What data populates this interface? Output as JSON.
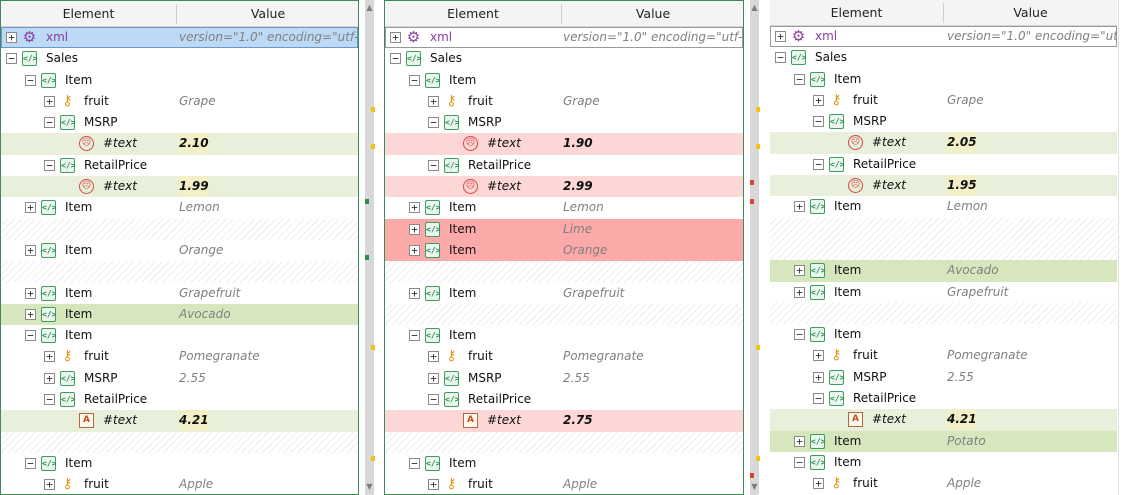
{
  "columns": {
    "element": "Element",
    "value": "Value"
  },
  "panes": {
    "left": [
      {
        "exp": "+",
        "icon": "gear",
        "name": "xml",
        "purple": true,
        "value": "version=\"1.0\" encoding=\"utf-",
        "state": "sel",
        "lvl": 0
      },
      {
        "exp": "-",
        "icon": "el",
        "name": "Sales",
        "lvl": 0
      },
      {
        "exp": "-",
        "icon": "el",
        "name": "Item",
        "lvl": 1
      },
      {
        "exp": "+",
        "icon": "key",
        "name": "fruit",
        "value": "Grape",
        "lvl": 2
      },
      {
        "exp": "-",
        "icon": "el",
        "name": "MSRP",
        "lvl": 2
      },
      {
        "icon": "sad",
        "name": "#text",
        "it": true,
        "value": "2.10",
        "num": true,
        "state": "diff-light",
        "lvl": 3
      },
      {
        "exp": "-",
        "icon": "el",
        "name": "RetailPrice",
        "lvl": 2
      },
      {
        "icon": "sad",
        "name": "#text",
        "it": true,
        "value": "1.99",
        "num": true,
        "state": "diff-light",
        "lvl": 3
      },
      {
        "exp": "+",
        "icon": "el",
        "name": "Item",
        "value": "Lemon",
        "lvl": 1
      },
      {
        "state": "hatch"
      },
      {
        "exp": "+",
        "icon": "el",
        "name": "Item",
        "value": "Orange",
        "lvl": 1
      },
      {
        "state": "hatch"
      },
      {
        "exp": "+",
        "icon": "el",
        "name": "Item",
        "value": "Grapefruit",
        "lvl": 1
      },
      {
        "exp": "+",
        "icon": "el",
        "name": "Item",
        "value": "Avocado",
        "state": "diff-green",
        "lvl": 1
      },
      {
        "exp": "-",
        "icon": "el",
        "name": "Item",
        "lvl": 1
      },
      {
        "exp": "+",
        "icon": "key",
        "name": "fruit",
        "value": "Pomegranate",
        "lvl": 2
      },
      {
        "exp": "+",
        "icon": "el",
        "name": "MSRP",
        "value": "2.55",
        "lvl": 2
      },
      {
        "exp": "-",
        "icon": "el",
        "name": "RetailPrice",
        "lvl": 2
      },
      {
        "icon": "doc",
        "name": "#text",
        "it": true,
        "value": "4.21",
        "num": true,
        "state": "diff-light",
        "lvl": 3
      },
      {
        "state": "hatch"
      },
      {
        "exp": "-",
        "icon": "el",
        "name": "Item",
        "lvl": 1
      },
      {
        "exp": "+",
        "icon": "key",
        "name": "fruit",
        "value": "Apple",
        "lvl": 2
      }
    ],
    "mid": [
      {
        "exp": "+",
        "icon": "gear",
        "name": "xml",
        "purple": true,
        "value": "version=\"1.0\" encoding=\"utf-",
        "state": "sel-gray",
        "lvl": 0
      },
      {
        "exp": "-",
        "icon": "el",
        "name": "Sales",
        "lvl": 0
      },
      {
        "exp": "-",
        "icon": "el",
        "name": "Item",
        "lvl": 1
      },
      {
        "exp": "+",
        "icon": "key",
        "name": "fruit",
        "value": "Grape",
        "lvl": 2
      },
      {
        "exp": "-",
        "icon": "el",
        "name": "MSRP",
        "lvl": 2
      },
      {
        "icon": "sad",
        "name": "#text",
        "it": true,
        "value": "1.90",
        "num": true,
        "state": "diff-pink",
        "lvl": 3
      },
      {
        "exp": "-",
        "icon": "el",
        "name": "RetailPrice",
        "lvl": 2
      },
      {
        "icon": "sad",
        "name": "#text",
        "it": true,
        "value": "2.99",
        "num": true,
        "state": "diff-pink",
        "lvl": 3
      },
      {
        "exp": "+",
        "icon": "el",
        "name": "Item",
        "value": "Lemon",
        "lvl": 1
      },
      {
        "exp": "+",
        "icon": "el",
        "name": "Item",
        "value": "Lime",
        "state": "diff-red",
        "lvl": 1
      },
      {
        "exp": "+",
        "icon": "el",
        "name": "Item",
        "value": "Orange",
        "state": "diff-red",
        "lvl": 1
      },
      {
        "state": "hatch"
      },
      {
        "exp": "+",
        "icon": "el",
        "name": "Item",
        "value": "Grapefruit",
        "lvl": 1
      },
      {
        "state": "hatch"
      },
      {
        "exp": "-",
        "icon": "el",
        "name": "Item",
        "lvl": 1
      },
      {
        "exp": "+",
        "icon": "key",
        "name": "fruit",
        "value": "Pomegranate",
        "lvl": 2
      },
      {
        "exp": "+",
        "icon": "el",
        "name": "MSRP",
        "value": "2.55",
        "lvl": 2
      },
      {
        "exp": "-",
        "icon": "el",
        "name": "RetailPrice",
        "lvl": 2
      },
      {
        "icon": "doc",
        "name": "#text",
        "it": true,
        "value": "2.75",
        "num": true,
        "state": "diff-pink",
        "lvl": 3
      },
      {
        "state": "hatch"
      },
      {
        "exp": "-",
        "icon": "el",
        "name": "Item",
        "lvl": 1
      },
      {
        "exp": "+",
        "icon": "key",
        "name": "fruit",
        "value": "Apple",
        "lvl": 2
      }
    ],
    "right": [
      {
        "exp": "+",
        "icon": "gear",
        "name": "xml",
        "purple": true,
        "value": "version=\"1.0\" encoding=\"utf-",
        "state": "sel-gray",
        "lvl": 0
      },
      {
        "exp": "-",
        "icon": "el",
        "name": "Sales",
        "lvl": 0
      },
      {
        "exp": "-",
        "icon": "el",
        "name": "Item",
        "lvl": 1
      },
      {
        "exp": "+",
        "icon": "key",
        "name": "fruit",
        "value": "Grape",
        "lvl": 2
      },
      {
        "exp": "-",
        "icon": "el",
        "name": "MSRP",
        "lvl": 2
      },
      {
        "icon": "sad",
        "name": "#text",
        "it": true,
        "value": "2.05",
        "num": true,
        "state": "diff-light",
        "lvl": 3
      },
      {
        "exp": "-",
        "icon": "el",
        "name": "RetailPrice",
        "lvl": 2
      },
      {
        "icon": "sad",
        "name": "#text",
        "it": true,
        "value": "1.95",
        "num": true,
        "state": "diff-light",
        "lvl": 3
      },
      {
        "exp": "+",
        "icon": "el",
        "name": "Item",
        "value": "Lemon",
        "lvl": 1
      },
      {
        "state": "hatch"
      },
      {
        "state": "hatch"
      },
      {
        "exp": "+",
        "icon": "el",
        "name": "Item",
        "value": "Avocado",
        "state": "diff-green",
        "lvl": 1
      },
      {
        "exp": "+",
        "icon": "el",
        "name": "Item",
        "value": "Grapefruit",
        "lvl": 1
      },
      {
        "state": "hatch"
      },
      {
        "exp": "-",
        "icon": "el",
        "name": "Item",
        "lvl": 1
      },
      {
        "exp": "+",
        "icon": "key",
        "name": "fruit",
        "value": "Pomegranate",
        "lvl": 2
      },
      {
        "exp": "+",
        "icon": "el",
        "name": "MSRP",
        "value": "2.55",
        "lvl": 2
      },
      {
        "exp": "-",
        "icon": "el",
        "name": "RetailPrice",
        "lvl": 2
      },
      {
        "icon": "doc",
        "name": "#text",
        "it": true,
        "value": "4.21",
        "num": true,
        "state": "diff-light",
        "lvl": 3
      },
      {
        "exp": "+",
        "icon": "el",
        "name": "Item",
        "value": "Potato",
        "state": "diff-green",
        "lvl": 1
      },
      {
        "exp": "-",
        "icon": "el",
        "name": "Item",
        "lvl": 1
      },
      {
        "exp": "+",
        "icon": "key",
        "name": "fruit",
        "value": "Apple",
        "lvl": 2
      }
    ]
  },
  "colors": {
    "diff_light": "#e8f0dc",
    "diff_green": "#d6e6bd",
    "diff_pink": "#fdd6d6",
    "diff_red": "#fca9a9",
    "selection": "#bcd9f5",
    "xml_purple": "#8a3d9f"
  }
}
